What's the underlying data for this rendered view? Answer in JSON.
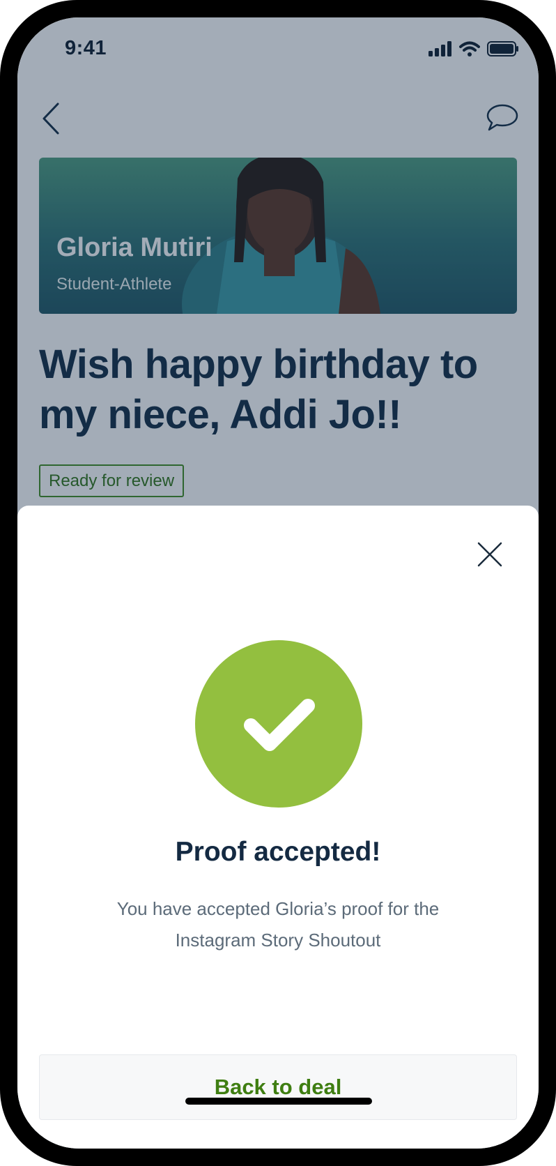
{
  "status_bar": {
    "time": "9:41",
    "icons": [
      "signal-icon",
      "wifi-icon",
      "battery-icon"
    ]
  },
  "nav": {
    "back_icon": "chevron-left-icon",
    "chat_icon": "chat-bubble-icon"
  },
  "athlete": {
    "name": "Gloria Mutiri",
    "role": "Student-Athlete"
  },
  "deal": {
    "title": "Wish happy birthday to my niece, Addi Jo!!",
    "status": "Ready for review"
  },
  "sheet": {
    "close_icon": "close-icon",
    "success_icon": "check-circle-icon",
    "title": "Proof accepted!",
    "message": "You have accepted Gloria’s proof for the Instagram Story Shoutout",
    "button_label": "Back to deal"
  },
  "colors": {
    "success": "#93bf3f",
    "accent_green": "#3f7e12",
    "heading": "#0f2a44"
  }
}
